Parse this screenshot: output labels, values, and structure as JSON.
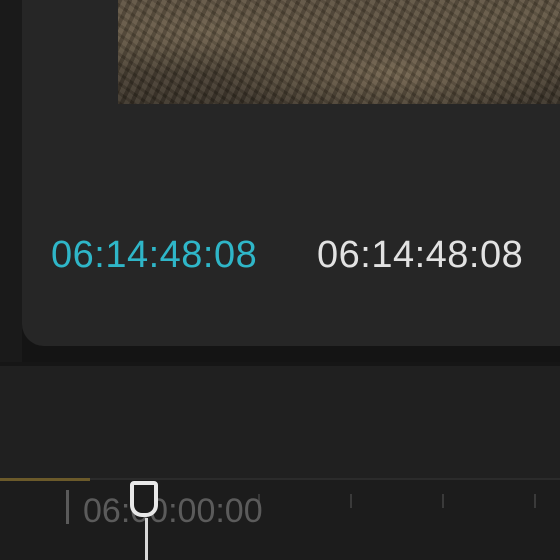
{
  "viewer": {
    "current_timecode": "06:14:48:08",
    "duration_timecode": "06:14:48:08",
    "current_timecode_color": "#2fb6c8",
    "duration_timecode_color": "#e2e2e2"
  },
  "timeline": {
    "ruler_label": "06:00:00:00",
    "playhead_color": "#e8e8e8"
  }
}
